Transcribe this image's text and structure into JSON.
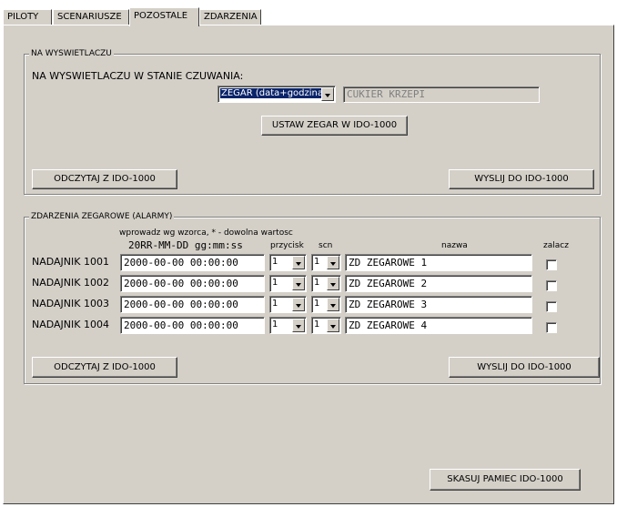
{
  "tabs": [
    "PILOTY",
    "SCENARIUSZE",
    "POZOSTALE",
    "ZDARZENIA"
  ],
  "active_tab": "POZOSTALE",
  "display": {
    "group_title": "NA WYSWIETLACZU",
    "standby_label": "NA WYSWIETLACZU W STANIE CZUWANIA:",
    "mode_select": "ZEGAR (data+godzina)",
    "text_field": "CUKIER KRZEPI",
    "set_clock_button": "USTAW ZEGAR W IDO-1000",
    "read_button": "ODCZYTAJ Z IDO-1000",
    "send_button": "WYSLIJ DO IDO-1000"
  },
  "alarms": {
    "group_title": "ZDARZENIA ZEGAROWE (ALARMY)",
    "hint": "wprowadz wg wzorca, * - dowolna wartosc",
    "pattern": "20RR-MM-DD gg:mm:ss",
    "columns": {
      "button": "przycisk",
      "scn": "scn",
      "name": "nazwa",
      "enable": "zalacz"
    },
    "rows": [
      {
        "label": "NADAJNIK 1001",
        "datetime": "2000-00-00 00:00:00",
        "button": "1",
        "scn": "1",
        "name": "ZD ZEGAROWE 1",
        "enabled": false
      },
      {
        "label": "NADAJNIK 1002",
        "datetime": "2000-00-00 00:00:00",
        "button": "1",
        "scn": "1",
        "name": "ZD ZEGAROWE 2",
        "enabled": false
      },
      {
        "label": "NADAJNIK 1003",
        "datetime": "2000-00-00 00:00:00",
        "button": "1",
        "scn": "1",
        "name": "ZD ZEGAROWE 3",
        "enabled": false
      },
      {
        "label": "NADAJNIK 1004",
        "datetime": "2000-00-00 00:00:00",
        "button": "1",
        "scn": "1",
        "name": "ZD ZEGAROWE 4",
        "enabled": false
      }
    ],
    "read_button": "ODCZYTAJ Z IDO-1000",
    "send_button": "WYSLIJ DO IDO-1000"
  },
  "erase_button": "SKASUJ PAMIEC IDO-1000"
}
